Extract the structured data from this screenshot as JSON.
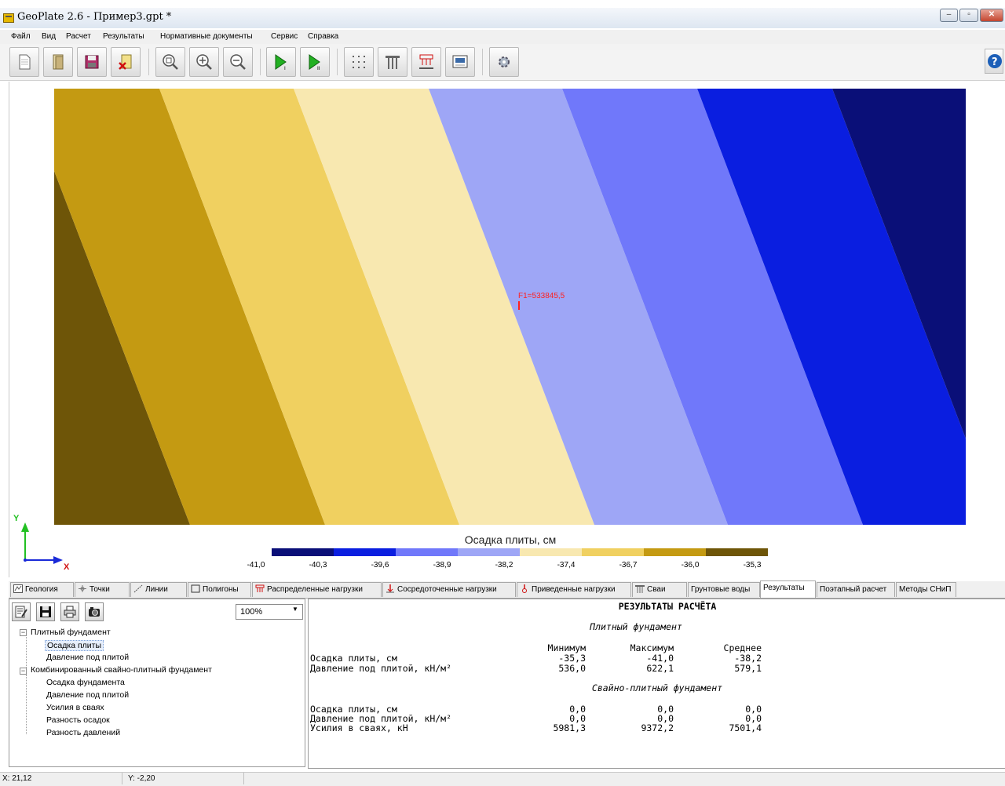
{
  "window": {
    "title": "GeoPlate 2.6  -  Пример3.gpt *"
  },
  "menu": [
    "Файл",
    "Вид",
    "Расчет",
    "Результаты",
    "Нормативные документы",
    "Сервис",
    "Справка"
  ],
  "toolbar": {
    "icons": [
      "new-file-icon",
      "open-file-icon",
      "save-icon",
      "close-file-icon",
      "zoom-fit-icon",
      "zoom-in-icon",
      "zoom-out-icon",
      "run-calc-1-icon",
      "run-calc-2-icon",
      "grid-icon",
      "piles-icon",
      "loads-icon",
      "report-icon",
      "settings-icon",
      "help-icon"
    ]
  },
  "plot": {
    "force_label": "F1=533845,5",
    "axis_x": "X",
    "axis_y": "Y",
    "band_colors": [
      "#6e5508",
      "#c49a12",
      "#f0d060",
      "#f8e8b0",
      "#9ea6f6",
      "#7078fa",
      "#0a1ee0",
      "#0a0f78"
    ]
  },
  "legend": {
    "title": "Осадка плиты, см",
    "ticks": [
      "-41,0",
      "-40,3",
      "-39,6",
      "-38,9",
      "-38,2",
      "-37,4",
      "-36,7",
      "-36,0",
      "-35,3"
    ],
    "colors": [
      "#0a0f78",
      "#0a1ee0",
      "#7078fa",
      "#9ea6f6",
      "#f8e8b0",
      "#f0d060",
      "#c49a12",
      "#6e5508"
    ]
  },
  "tabs": [
    {
      "label": "Геология",
      "icon": "geology-icon"
    },
    {
      "label": "Точки",
      "icon": "points-icon"
    },
    {
      "label": "Линии",
      "icon": "lines-icon"
    },
    {
      "label": "Полигоны",
      "icon": "polygons-icon"
    },
    {
      "label": "Распределенные нагрузки",
      "icon": "distributed-loads-icon"
    },
    {
      "label": "Сосредоточенные нагрузки",
      "icon": "point-loads-icon"
    },
    {
      "label": "Приведенные нагрузки",
      "icon": "reduced-loads-icon"
    },
    {
      "label": "Сваи",
      "icon": "piles-icon"
    },
    {
      "label": "Грунтовые воды",
      "icon": ""
    },
    {
      "label": "Результаты",
      "icon": ""
    },
    {
      "label": "Поэтапный расчет",
      "icon": ""
    },
    {
      "label": "Методы СНиП",
      "icon": ""
    }
  ],
  "left_panel": {
    "zoom": "100%",
    "tree": {
      "group1": "Плитный фундамент",
      "g1_items": [
        "Осадка плиты",
        "Давление под плитой"
      ],
      "group2": "Комбинированный свайно-плитный фундамент",
      "g2_items": [
        "Осадка фундамента",
        "Давление под плитой",
        "Усилия в сваях",
        "Разность осадок",
        "Разность давлений"
      ]
    }
  },
  "results": {
    "title": "РЕЗУЛЬТАТЫ РАСЧЁТА",
    "section1": "Плитный фундамент",
    "col_min": "Минимум",
    "col_max": "Максимум",
    "col_avg": "Среднее",
    "rows1": [
      {
        "label": "Осадка плиты, см",
        "min": "-35,3",
        "max": "-41,0",
        "avg": "-38,2"
      },
      {
        "label": "Давление под плитой, кН/м²",
        "min": "536,0",
        "max": "622,1",
        "avg": "579,1"
      }
    ],
    "section2": "Свайно-плитный фундамент",
    "rows2": [
      {
        "label": "Осадка плиты, см",
        "min": "0,0",
        "max": "0,0",
        "avg": "0,0"
      },
      {
        "label": "Давление под плитой, кН/м²",
        "min": "0,0",
        "max": "0,0",
        "avg": "0,0"
      },
      {
        "label": "Усилия в сваях, кН",
        "min": "5981,3",
        "max": "9372,2",
        "avg": "7501,4"
      }
    ]
  },
  "status": {
    "x": "X: 21,12",
    "y": "Y: -2,20"
  }
}
